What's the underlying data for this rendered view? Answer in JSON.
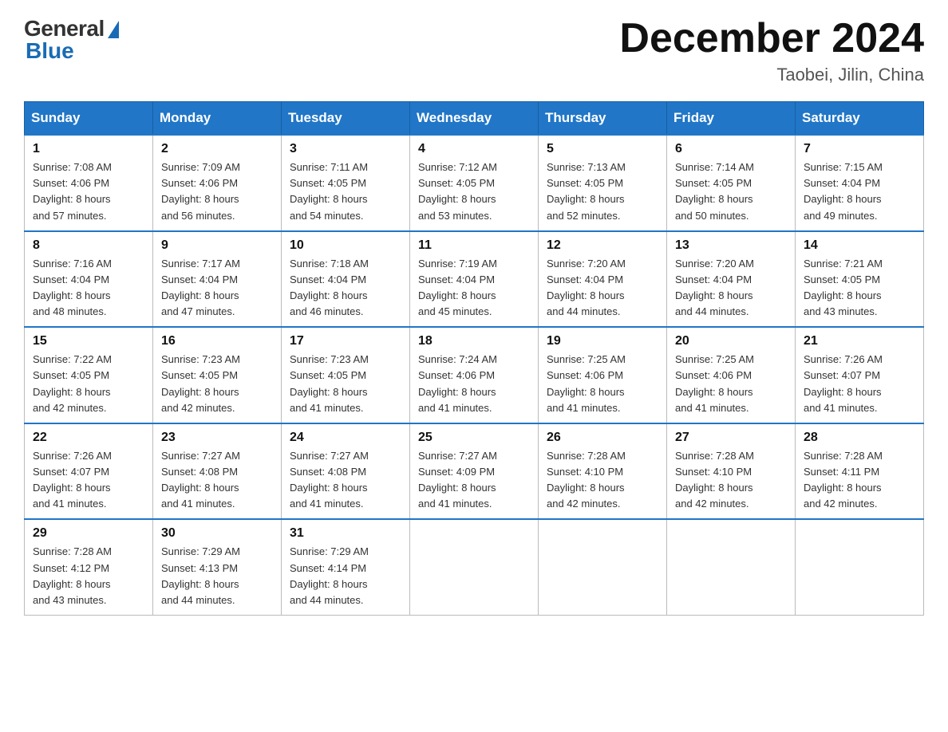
{
  "header": {
    "logo_general": "General",
    "logo_blue": "Blue",
    "month_title": "December 2024",
    "location": "Taobei, Jilin, China"
  },
  "calendar": {
    "days_of_week": [
      "Sunday",
      "Monday",
      "Tuesday",
      "Wednesday",
      "Thursday",
      "Friday",
      "Saturday"
    ],
    "weeks": [
      [
        {
          "day": "1",
          "sunrise": "7:08 AM",
          "sunset": "4:06 PM",
          "daylight": "8 hours and 57 minutes."
        },
        {
          "day": "2",
          "sunrise": "7:09 AM",
          "sunset": "4:06 PM",
          "daylight": "8 hours and 56 minutes."
        },
        {
          "day": "3",
          "sunrise": "7:11 AM",
          "sunset": "4:05 PM",
          "daylight": "8 hours and 54 minutes."
        },
        {
          "day": "4",
          "sunrise": "7:12 AM",
          "sunset": "4:05 PM",
          "daylight": "8 hours and 53 minutes."
        },
        {
          "day": "5",
          "sunrise": "7:13 AM",
          "sunset": "4:05 PM",
          "daylight": "8 hours and 52 minutes."
        },
        {
          "day": "6",
          "sunrise": "7:14 AM",
          "sunset": "4:05 PM",
          "daylight": "8 hours and 50 minutes."
        },
        {
          "day": "7",
          "sunrise": "7:15 AM",
          "sunset": "4:04 PM",
          "daylight": "8 hours and 49 minutes."
        }
      ],
      [
        {
          "day": "8",
          "sunrise": "7:16 AM",
          "sunset": "4:04 PM",
          "daylight": "8 hours and 48 minutes."
        },
        {
          "day": "9",
          "sunrise": "7:17 AM",
          "sunset": "4:04 PM",
          "daylight": "8 hours and 47 minutes."
        },
        {
          "day": "10",
          "sunrise": "7:18 AM",
          "sunset": "4:04 PM",
          "daylight": "8 hours and 46 minutes."
        },
        {
          "day": "11",
          "sunrise": "7:19 AM",
          "sunset": "4:04 PM",
          "daylight": "8 hours and 45 minutes."
        },
        {
          "day": "12",
          "sunrise": "7:20 AM",
          "sunset": "4:04 PM",
          "daylight": "8 hours and 44 minutes."
        },
        {
          "day": "13",
          "sunrise": "7:20 AM",
          "sunset": "4:04 PM",
          "daylight": "8 hours and 44 minutes."
        },
        {
          "day": "14",
          "sunrise": "7:21 AM",
          "sunset": "4:05 PM",
          "daylight": "8 hours and 43 minutes."
        }
      ],
      [
        {
          "day": "15",
          "sunrise": "7:22 AM",
          "sunset": "4:05 PM",
          "daylight": "8 hours and 42 minutes."
        },
        {
          "day": "16",
          "sunrise": "7:23 AM",
          "sunset": "4:05 PM",
          "daylight": "8 hours and 42 minutes."
        },
        {
          "day": "17",
          "sunrise": "7:23 AM",
          "sunset": "4:05 PM",
          "daylight": "8 hours and 41 minutes."
        },
        {
          "day": "18",
          "sunrise": "7:24 AM",
          "sunset": "4:06 PM",
          "daylight": "8 hours and 41 minutes."
        },
        {
          "day": "19",
          "sunrise": "7:25 AM",
          "sunset": "4:06 PM",
          "daylight": "8 hours and 41 minutes."
        },
        {
          "day": "20",
          "sunrise": "7:25 AM",
          "sunset": "4:06 PM",
          "daylight": "8 hours and 41 minutes."
        },
        {
          "day": "21",
          "sunrise": "7:26 AM",
          "sunset": "4:07 PM",
          "daylight": "8 hours and 41 minutes."
        }
      ],
      [
        {
          "day": "22",
          "sunrise": "7:26 AM",
          "sunset": "4:07 PM",
          "daylight": "8 hours and 41 minutes."
        },
        {
          "day": "23",
          "sunrise": "7:27 AM",
          "sunset": "4:08 PM",
          "daylight": "8 hours and 41 minutes."
        },
        {
          "day": "24",
          "sunrise": "7:27 AM",
          "sunset": "4:08 PM",
          "daylight": "8 hours and 41 minutes."
        },
        {
          "day": "25",
          "sunrise": "7:27 AM",
          "sunset": "4:09 PM",
          "daylight": "8 hours and 41 minutes."
        },
        {
          "day": "26",
          "sunrise": "7:28 AM",
          "sunset": "4:10 PM",
          "daylight": "8 hours and 42 minutes."
        },
        {
          "day": "27",
          "sunrise": "7:28 AM",
          "sunset": "4:10 PM",
          "daylight": "8 hours and 42 minutes."
        },
        {
          "day": "28",
          "sunrise": "7:28 AM",
          "sunset": "4:11 PM",
          "daylight": "8 hours and 42 minutes."
        }
      ],
      [
        {
          "day": "29",
          "sunrise": "7:28 AM",
          "sunset": "4:12 PM",
          "daylight": "8 hours and 43 minutes."
        },
        {
          "day": "30",
          "sunrise": "7:29 AM",
          "sunset": "4:13 PM",
          "daylight": "8 hours and 44 minutes."
        },
        {
          "day": "31",
          "sunrise": "7:29 AM",
          "sunset": "4:14 PM",
          "daylight": "8 hours and 44 minutes."
        },
        null,
        null,
        null,
        null
      ]
    ],
    "labels": {
      "sunrise": "Sunrise:",
      "sunset": "Sunset:",
      "daylight": "Daylight:"
    }
  }
}
